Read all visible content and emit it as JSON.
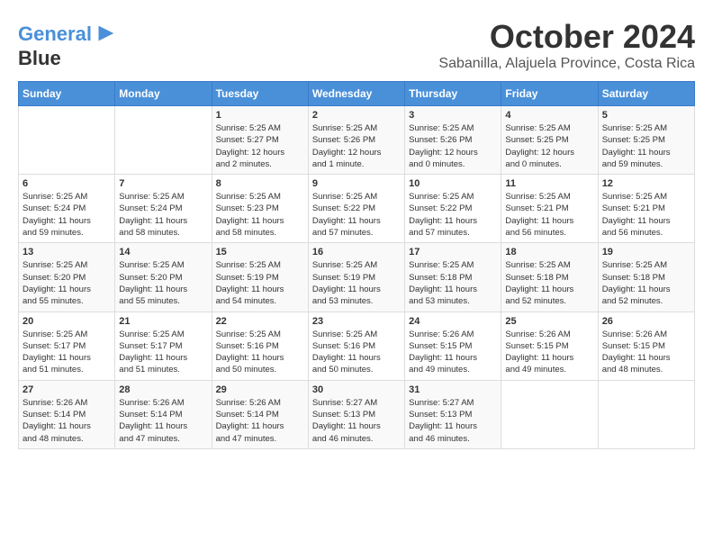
{
  "logo": {
    "line1": "General",
    "line2": "Blue"
  },
  "title": "October 2024",
  "subtitle": "Sabanilla, Alajuela Province, Costa Rica",
  "days_of_week": [
    "Sunday",
    "Monday",
    "Tuesday",
    "Wednesday",
    "Thursday",
    "Friday",
    "Saturday"
  ],
  "weeks": [
    [
      {
        "day": "",
        "info": ""
      },
      {
        "day": "",
        "info": ""
      },
      {
        "day": "1",
        "info": "Sunrise: 5:25 AM\nSunset: 5:27 PM\nDaylight: 12 hours\nand 2 minutes."
      },
      {
        "day": "2",
        "info": "Sunrise: 5:25 AM\nSunset: 5:26 PM\nDaylight: 12 hours\nand 1 minute."
      },
      {
        "day": "3",
        "info": "Sunrise: 5:25 AM\nSunset: 5:26 PM\nDaylight: 12 hours\nand 0 minutes."
      },
      {
        "day": "4",
        "info": "Sunrise: 5:25 AM\nSunset: 5:25 PM\nDaylight: 12 hours\nand 0 minutes."
      },
      {
        "day": "5",
        "info": "Sunrise: 5:25 AM\nSunset: 5:25 PM\nDaylight: 11 hours\nand 59 minutes."
      }
    ],
    [
      {
        "day": "6",
        "info": "Sunrise: 5:25 AM\nSunset: 5:24 PM\nDaylight: 11 hours\nand 59 minutes."
      },
      {
        "day": "7",
        "info": "Sunrise: 5:25 AM\nSunset: 5:24 PM\nDaylight: 11 hours\nand 58 minutes."
      },
      {
        "day": "8",
        "info": "Sunrise: 5:25 AM\nSunset: 5:23 PM\nDaylight: 11 hours\nand 58 minutes."
      },
      {
        "day": "9",
        "info": "Sunrise: 5:25 AM\nSunset: 5:22 PM\nDaylight: 11 hours\nand 57 minutes."
      },
      {
        "day": "10",
        "info": "Sunrise: 5:25 AM\nSunset: 5:22 PM\nDaylight: 11 hours\nand 57 minutes."
      },
      {
        "day": "11",
        "info": "Sunrise: 5:25 AM\nSunset: 5:21 PM\nDaylight: 11 hours\nand 56 minutes."
      },
      {
        "day": "12",
        "info": "Sunrise: 5:25 AM\nSunset: 5:21 PM\nDaylight: 11 hours\nand 56 minutes."
      }
    ],
    [
      {
        "day": "13",
        "info": "Sunrise: 5:25 AM\nSunset: 5:20 PM\nDaylight: 11 hours\nand 55 minutes."
      },
      {
        "day": "14",
        "info": "Sunrise: 5:25 AM\nSunset: 5:20 PM\nDaylight: 11 hours\nand 55 minutes."
      },
      {
        "day": "15",
        "info": "Sunrise: 5:25 AM\nSunset: 5:19 PM\nDaylight: 11 hours\nand 54 minutes."
      },
      {
        "day": "16",
        "info": "Sunrise: 5:25 AM\nSunset: 5:19 PM\nDaylight: 11 hours\nand 53 minutes."
      },
      {
        "day": "17",
        "info": "Sunrise: 5:25 AM\nSunset: 5:18 PM\nDaylight: 11 hours\nand 53 minutes."
      },
      {
        "day": "18",
        "info": "Sunrise: 5:25 AM\nSunset: 5:18 PM\nDaylight: 11 hours\nand 52 minutes."
      },
      {
        "day": "19",
        "info": "Sunrise: 5:25 AM\nSunset: 5:18 PM\nDaylight: 11 hours\nand 52 minutes."
      }
    ],
    [
      {
        "day": "20",
        "info": "Sunrise: 5:25 AM\nSunset: 5:17 PM\nDaylight: 11 hours\nand 51 minutes."
      },
      {
        "day": "21",
        "info": "Sunrise: 5:25 AM\nSunset: 5:17 PM\nDaylight: 11 hours\nand 51 minutes."
      },
      {
        "day": "22",
        "info": "Sunrise: 5:25 AM\nSunset: 5:16 PM\nDaylight: 11 hours\nand 50 minutes."
      },
      {
        "day": "23",
        "info": "Sunrise: 5:25 AM\nSunset: 5:16 PM\nDaylight: 11 hours\nand 50 minutes."
      },
      {
        "day": "24",
        "info": "Sunrise: 5:26 AM\nSunset: 5:15 PM\nDaylight: 11 hours\nand 49 minutes."
      },
      {
        "day": "25",
        "info": "Sunrise: 5:26 AM\nSunset: 5:15 PM\nDaylight: 11 hours\nand 49 minutes."
      },
      {
        "day": "26",
        "info": "Sunrise: 5:26 AM\nSunset: 5:15 PM\nDaylight: 11 hours\nand 48 minutes."
      }
    ],
    [
      {
        "day": "27",
        "info": "Sunrise: 5:26 AM\nSunset: 5:14 PM\nDaylight: 11 hours\nand 48 minutes."
      },
      {
        "day": "28",
        "info": "Sunrise: 5:26 AM\nSunset: 5:14 PM\nDaylight: 11 hours\nand 47 minutes."
      },
      {
        "day": "29",
        "info": "Sunrise: 5:26 AM\nSunset: 5:14 PM\nDaylight: 11 hours\nand 47 minutes."
      },
      {
        "day": "30",
        "info": "Sunrise: 5:27 AM\nSunset: 5:13 PM\nDaylight: 11 hours\nand 46 minutes."
      },
      {
        "day": "31",
        "info": "Sunrise: 5:27 AM\nSunset: 5:13 PM\nDaylight: 11 hours\nand 46 minutes."
      },
      {
        "day": "",
        "info": ""
      },
      {
        "day": "",
        "info": ""
      }
    ]
  ]
}
